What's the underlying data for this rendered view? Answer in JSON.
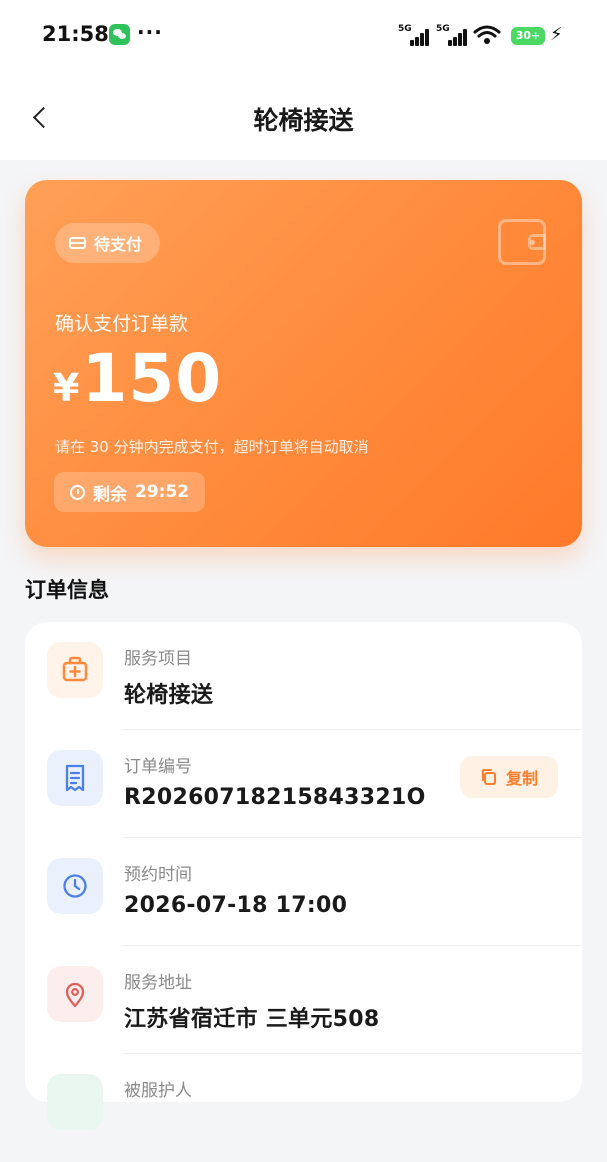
{
  "status_bar": {
    "time": "21:58",
    "more": "···",
    "network1": "5G",
    "network2": "5G",
    "battery": "30+"
  },
  "header": {
    "title": "轮椅接送"
  },
  "payment": {
    "status": "待支付",
    "label": "确认支付订单款",
    "currency": "¥",
    "amount": "150",
    "hint": "请在 30 分钟内完成支付，超时订单将自动取消",
    "countdown_label": "剩余",
    "countdown": "29:52"
  },
  "order": {
    "section_title": "订单信息",
    "items": [
      {
        "label": "服务项目",
        "value": "轮椅接送",
        "icon": "medical-kit-icon"
      },
      {
        "label": "订单编号",
        "value": "R20260718215843321O",
        "icon": "receipt-icon"
      },
      {
        "label": "预约时间",
        "value": "2026-07-18 17:00",
        "icon": "clock-icon"
      },
      {
        "label": "服务地址",
        "value": "江苏省宿迁市 三单元508",
        "icon": "location-pin-icon"
      },
      {
        "label": "被服护人",
        "value": "",
        "icon": "person-icon"
      }
    ],
    "copy_label": "复制"
  },
  "colors": {
    "accent": "#ff7d2b",
    "card_gradient_start": "#ffa057",
    "card_gradient_end": "#ff7a2a",
    "background": "#f4f5f7"
  }
}
